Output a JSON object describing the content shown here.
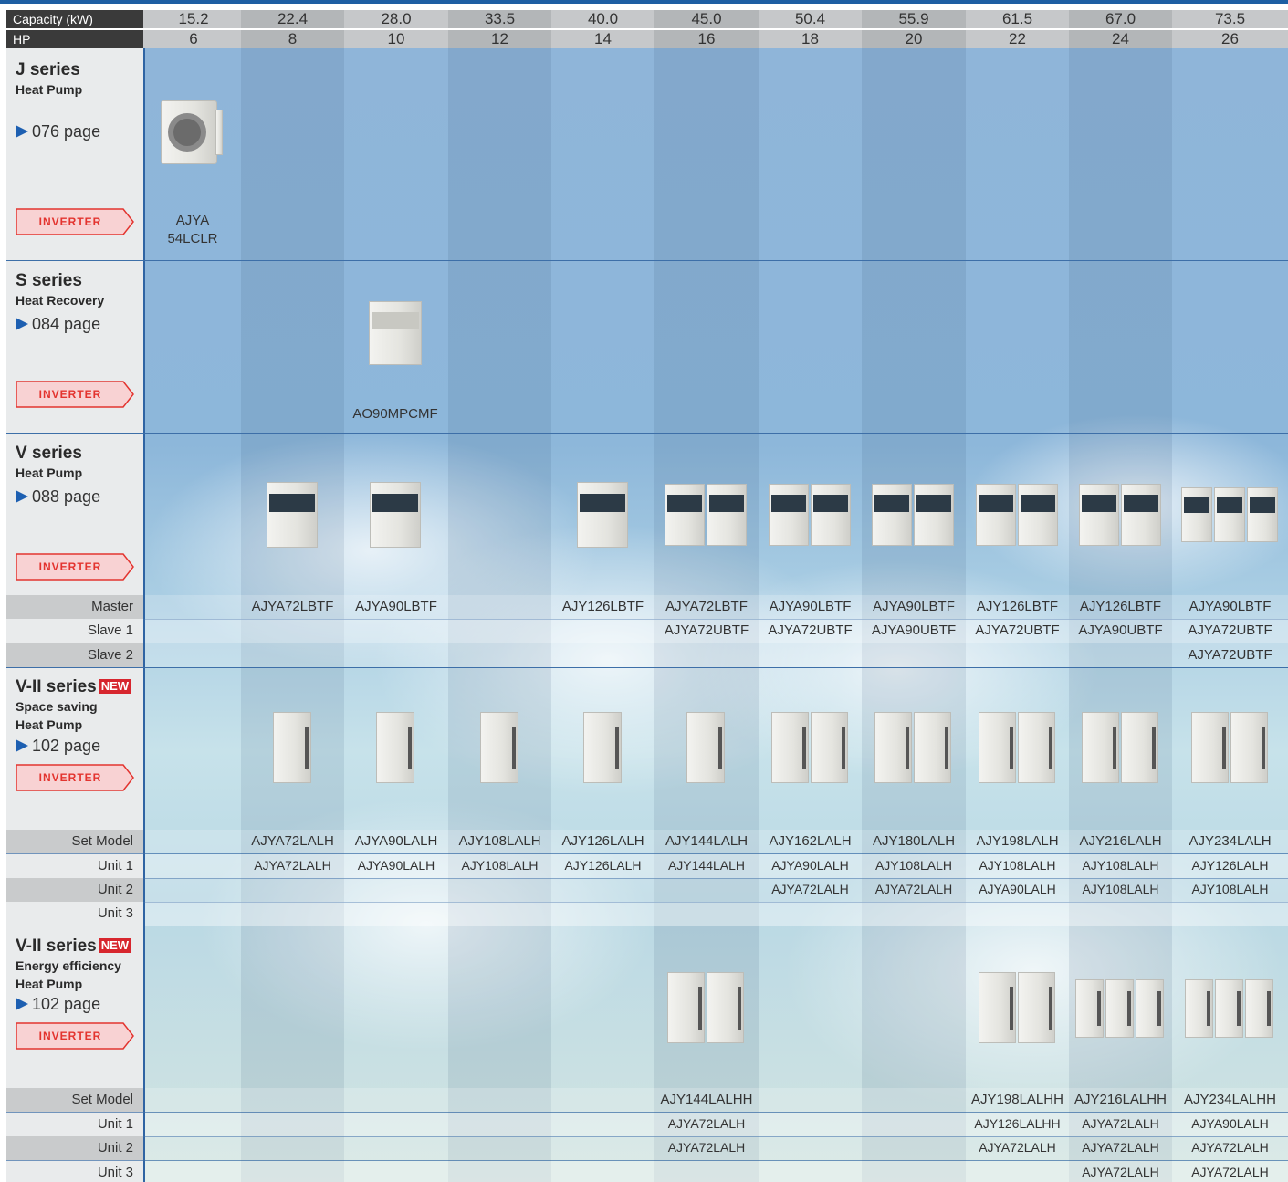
{
  "header": {
    "capacity_label": "Capacity (kW)",
    "hp_label": "HP",
    "capacity": [
      "15.2",
      "22.4",
      "28.0",
      "33.5",
      "40.0",
      "45.0",
      "50.4",
      "55.9",
      "61.5",
      "67.0",
      "73.5"
    ],
    "hp": [
      "6",
      "8",
      "10",
      "12",
      "14",
      "16",
      "18",
      "20",
      "22",
      "24",
      "26"
    ]
  },
  "j_series": {
    "title": "J series",
    "subtitle": "Heat Pump",
    "page": "076 page",
    "badge": "INVERTER",
    "model_line1": "AJYA",
    "model_line2": "54LCLR"
  },
  "s_series": {
    "title": "S series",
    "subtitle": "Heat Recovery",
    "page": "084 page",
    "badge": "INVERTER",
    "model": "AO90MPCMF"
  },
  "v_series": {
    "title": "V series",
    "subtitle": "Heat Pump",
    "page": "088 page",
    "badge": "INVERTER",
    "row_labels": [
      "Master",
      "Slave 1",
      "Slave 2"
    ],
    "master": [
      "",
      "AJYA72LBTF",
      "AJYA90LBTF",
      "",
      "AJY126LBTF",
      "AJYA72LBTF",
      "AJYA90LBTF",
      "AJYA90LBTF",
      "AJY126LBTF",
      "AJY126LBTF",
      "AJYA90LBTF"
    ],
    "slave1": [
      "",
      "",
      "",
      "",
      "",
      "AJYA72UBTF",
      "AJYA72UBTF",
      "AJYA90UBTF",
      "AJYA72UBTF",
      "AJYA90UBTF",
      "AJYA72UBTF"
    ],
    "slave2": [
      "",
      "",
      "",
      "",
      "",
      "",
      "",
      "",
      "",
      "",
      "AJYA72UBTF"
    ]
  },
  "v2_space": {
    "title": "V-II series",
    "new_badge": "NEW",
    "subtitle1": "Space saving",
    "subtitle2": "Heat Pump",
    "page": "102 page",
    "badge": "INVERTER",
    "row_labels": [
      "Set Model",
      "Unit 1",
      "Unit 2",
      "Unit 3"
    ],
    "set_model": [
      "",
      "AJYA72LALH",
      "AJYA90LALH",
      "AJY108LALH",
      "AJY126LALH",
      "AJY144LALH",
      "AJY162LALH",
      "AJY180LALH",
      "AJY198LALH",
      "AJY216LALH",
      "AJY234LALH"
    ],
    "unit1": [
      "",
      "AJYA72LALH",
      "AJYA90LALH",
      "AJY108LALH",
      "AJY126LALH",
      "AJY144LALH",
      "AJYA90LALH",
      "AJY108LALH",
      "AJY108LALH",
      "AJY108LALH",
      "AJY126LALH"
    ],
    "unit2": [
      "",
      "",
      "",
      "",
      "",
      "",
      "AJYA72LALH",
      "AJYA72LALH",
      "AJYA90LALH",
      "AJY108LALH",
      "AJY108LALH"
    ],
    "unit3": [
      "",
      "",
      "",
      "",
      "",
      "",
      "",
      "",
      "",
      "",
      ""
    ]
  },
  "v2_energy": {
    "title": "V-II series",
    "new_badge": "NEW",
    "subtitle1": "Energy efficiency",
    "subtitle2": "Heat Pump",
    "page": "102 page",
    "badge": "INVERTER",
    "row_labels": [
      "Set Model",
      "Unit 1",
      "Unit 2",
      "Unit 3"
    ],
    "set_model": [
      "",
      "",
      "",
      "",
      "",
      "AJY144LALHH",
      "",
      "",
      "AJY198LALHH",
      "AJY216LALHH",
      "AJY234LALHH"
    ],
    "unit1": [
      "",
      "",
      "",
      "",
      "",
      "AJYA72LALH",
      "",
      "",
      "AJY126LALHH",
      "AJYA72LALH",
      "AJYA90LALH"
    ],
    "unit2": [
      "",
      "",
      "",
      "",
      "",
      "AJYA72LALH",
      "",
      "",
      "AJYA72LALH",
      "AJYA72LALH",
      "AJYA72LALH"
    ],
    "unit3": [
      "",
      "",
      "",
      "",
      "",
      "",
      "",
      "",
      "",
      "AJYA72LALH",
      "AJYA72LALH"
    ]
  },
  "colors": {
    "accent_blue": "#1e5fa3",
    "inverter_red": "#e3342f",
    "new_red": "#d7262e"
  }
}
